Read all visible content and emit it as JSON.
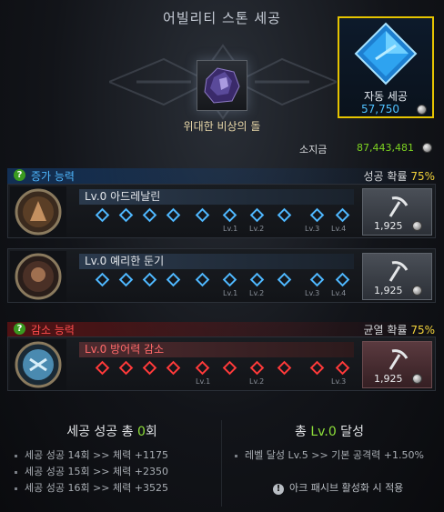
{
  "title": "어빌리티 스톤 세공",
  "stone_name": "위대한 비상의 돌",
  "auto_cut": {
    "label": "자동 세공",
    "count": "57,750"
  },
  "currency": {
    "label": "소지금",
    "value": "87,443,481"
  },
  "increase": {
    "title": "증가 능력",
    "rate_label": "성공 확률",
    "rate": "75%",
    "rows": [
      {
        "name": "Lv.0 아드레날린",
        "cost": "1,925",
        "lv_marks": [
          "Lv.1",
          "Lv.2",
          "Lv.3",
          "Lv.4"
        ]
      },
      {
        "name": "Lv.0 예리한 둔기",
        "cost": "1,925",
        "lv_marks": [
          "Lv.1",
          "Lv.2",
          "Lv.3",
          "Lv.4"
        ]
      }
    ]
  },
  "decrease": {
    "title": "감소 능력",
    "rate_label": "균열 확률",
    "rate": "75%",
    "rows": [
      {
        "name": "Lv.0 방어력 감소",
        "cost": "1,925",
        "lv_marks": [
          "Lv.1",
          "Lv.2",
          "Lv.3"
        ]
      }
    ]
  },
  "summary_left": {
    "prefix": "세공 성공 총 ",
    "count": "0",
    "suffix": "회",
    "items": [
      "세공 성공 14회 >> 체력 +1175",
      "세공 성공 15회 >> 체력 +2350",
      "세공 성공 16회 >> 체력 +3525"
    ]
  },
  "summary_right": {
    "prefix": "총 ",
    "level": "Lv.0",
    "suffix": " 달성",
    "items": [
      "레벨 달성 Lv.5 >> 기본 공격력 +1.50%"
    ],
    "note": "아크 패시브 활성화 시 적용"
  },
  "colors": {
    "accent_gold": "#e6c400",
    "increase": "#4fb8ff",
    "decrease": "#ff3a3a",
    "positive": "#7ed321"
  }
}
